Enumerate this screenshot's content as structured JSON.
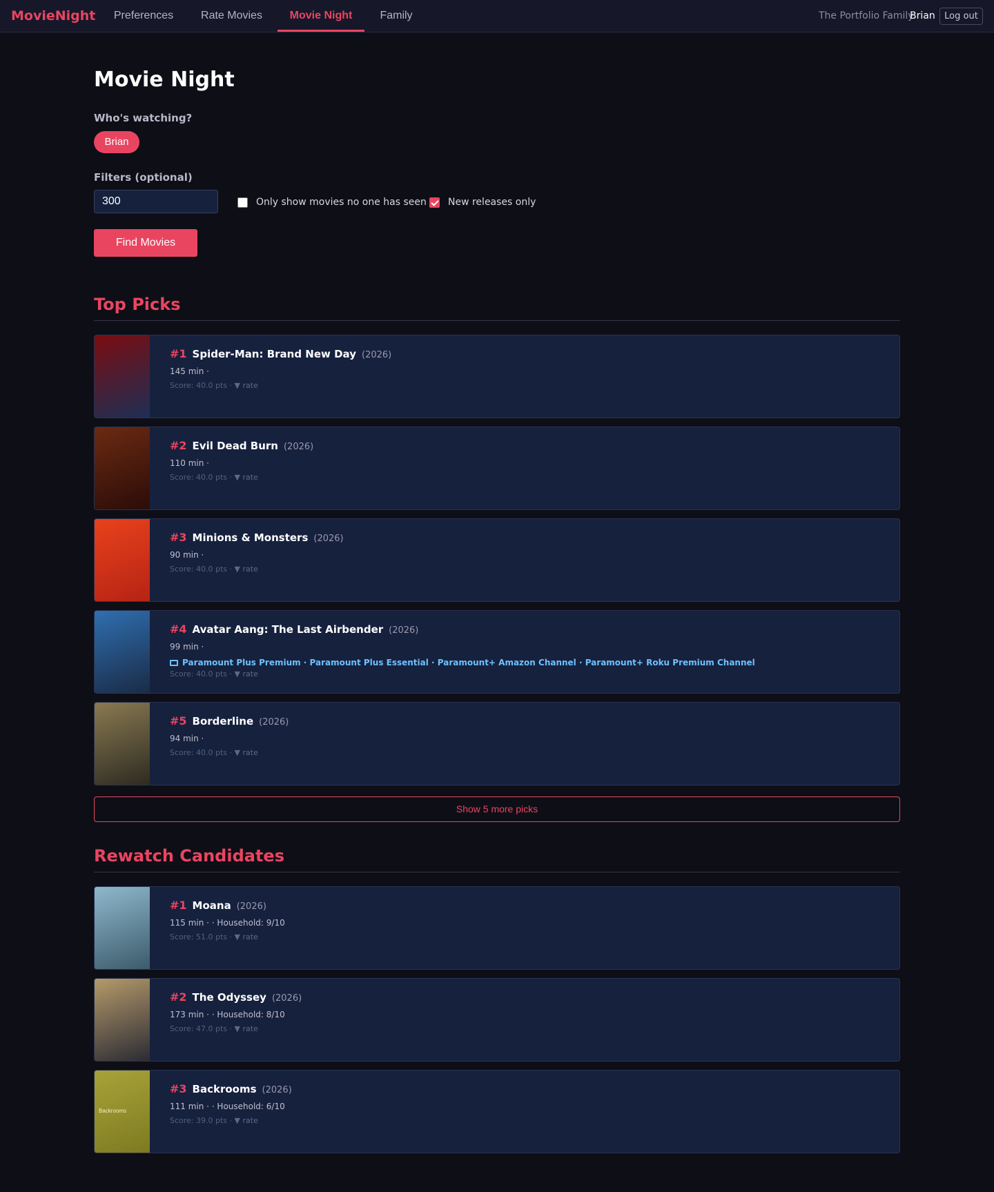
{
  "nav": {
    "brand": "MovieNight",
    "links": [
      "Preferences",
      "Rate Movies",
      "Movie Night",
      "Family"
    ],
    "family": "The Portfolio Family",
    "user": "Brian",
    "logout": "Log out"
  },
  "page": {
    "title": "Movie Night",
    "watching_label": "Who's watching?",
    "watcher": "Brian",
    "filters_label": "Filters (optional)",
    "filter_value": "300",
    "unseen_label": "Only show movies no one has seen",
    "unseen_checked": false,
    "new_label": "New releases only",
    "new_checked": true,
    "find_button": "Find Movies"
  },
  "top_picks": {
    "heading": "Top Picks",
    "more_button": "Show 5 more picks",
    "items": [
      {
        "rank": "#1",
        "title": "Spider-Man: Brand New Day",
        "year": "(2026)",
        "meta": "145 min ·",
        "score": "Score: 40.0 pts ·",
        "rate": "▼ rate",
        "poster_colors": [
          "#7a0d12",
          "#1c2f55"
        ]
      },
      {
        "rank": "#2",
        "title": "Evil Dead Burn",
        "year": "(2026)",
        "meta": "110 min ·",
        "score": "Score: 40.0 pts ·",
        "rate": "▼ rate",
        "poster_colors": [
          "#6b2a12",
          "#2a0c08"
        ]
      },
      {
        "rank": "#3",
        "title": "Minions & Monsters",
        "year": "(2026)",
        "meta": "90 min ·",
        "score": "Score: 40.0 pts ·",
        "rate": "▼ rate",
        "poster_colors": [
          "#e8421c",
          "#b52314"
        ]
      },
      {
        "rank": "#4",
        "title": "Avatar Aang: The Last Airbender",
        "year": "(2026)",
        "meta": "99 min ·",
        "providers": "Paramount Plus Premium · Paramount Plus Essential · Paramount+ Amazon Channel · Paramount+ Roku Premium Channel",
        "score": "Score: 40.0 pts ·",
        "rate": "▼ rate",
        "poster_colors": [
          "#2f6fb0",
          "#1a2a44"
        ]
      },
      {
        "rank": "#5",
        "title": "Borderline",
        "year": "(2026)",
        "meta": "94 min ·",
        "score": "Score: 40.0 pts ·",
        "rate": "▼ rate",
        "poster_colors": [
          "#8a7a52",
          "#2c2a20"
        ]
      }
    ]
  },
  "rewatch": {
    "heading": "Rewatch Candidates",
    "items": [
      {
        "rank": "#1",
        "title": "Moana",
        "year": "(2026)",
        "meta": "115 min · · Household: 9/10",
        "score": "Score: 51.0 pts ·",
        "rate": "▼ rate",
        "poster_colors": [
          "#8fb8cc",
          "#3a5a6a"
        ]
      },
      {
        "rank": "#2",
        "title": "The Odyssey",
        "year": "(2026)",
        "meta": "173 min · · Household: 8/10",
        "score": "Score: 47.0 pts ·",
        "rate": "▼ rate",
        "poster_colors": [
          "#b59a6a",
          "#2a2a34"
        ]
      },
      {
        "rank": "#3",
        "title": "Backrooms",
        "year": "(2026)",
        "meta": "111 min · · Household: 6/10",
        "score": "Score: 39.0 pts ·",
        "rate": "▼ rate",
        "poster_text": "Backrooms",
        "poster_colors": [
          "#a8a338",
          "#7c7a22"
        ]
      }
    ]
  }
}
